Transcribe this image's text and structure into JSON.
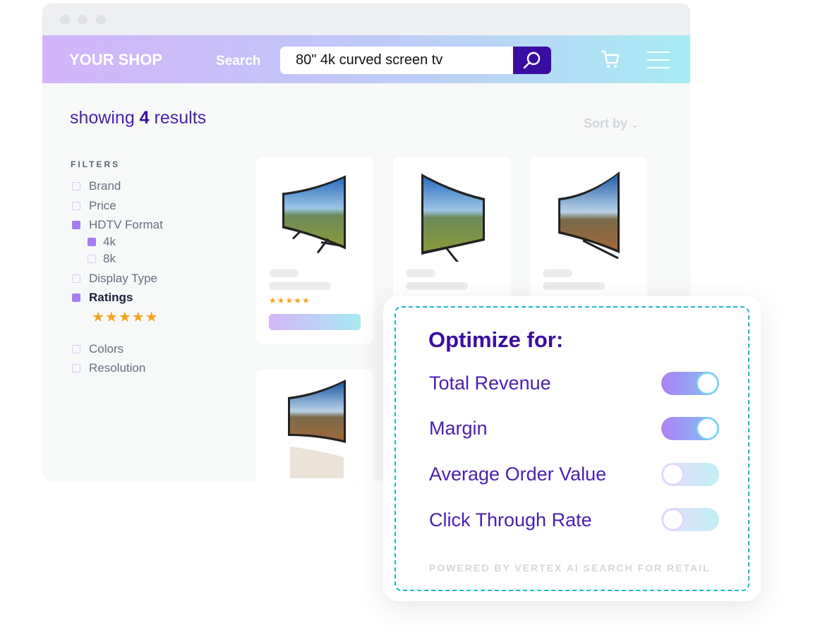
{
  "header": {
    "logo": "YOUR SHOP",
    "search_label": "Search",
    "search_value": "80\" 4k curved screen tv"
  },
  "results": {
    "prefix": "showing ",
    "count": "4",
    "suffix": " results",
    "sort_label": "Sort by"
  },
  "filters": {
    "title": "FILTERS",
    "items": [
      {
        "label": "Brand",
        "checked": false
      },
      {
        "label": "Price",
        "checked": false
      },
      {
        "label": "HDTV Format",
        "checked": true
      },
      {
        "label": "4k",
        "checked": true
      },
      {
        "label": "8k",
        "checked": false
      },
      {
        "label": "Display Type",
        "checked": false
      },
      {
        "label": "Ratings",
        "checked": true
      },
      {
        "label": "Colors",
        "checked": false
      },
      {
        "label": "Resolution",
        "checked": false
      }
    ],
    "rating_stars": "★★★★★"
  },
  "products": {
    "stars": "★★★★★"
  },
  "optimize": {
    "title": "Optimize for:",
    "options": [
      {
        "label": "Total Revenue",
        "on": true
      },
      {
        "label": "Margin",
        "on": true
      },
      {
        "label": "Average Order Value",
        "on": false
      },
      {
        "label": "Click Through Rate",
        "on": false
      }
    ],
    "powered": "POWERED BY VERTEX AI SEARCH FOR RETAIL"
  },
  "colors": {
    "accent": "#3b0ca3",
    "text": "#4a1fb0",
    "dash": "#1bb9c5",
    "star": "#f6a21e"
  }
}
